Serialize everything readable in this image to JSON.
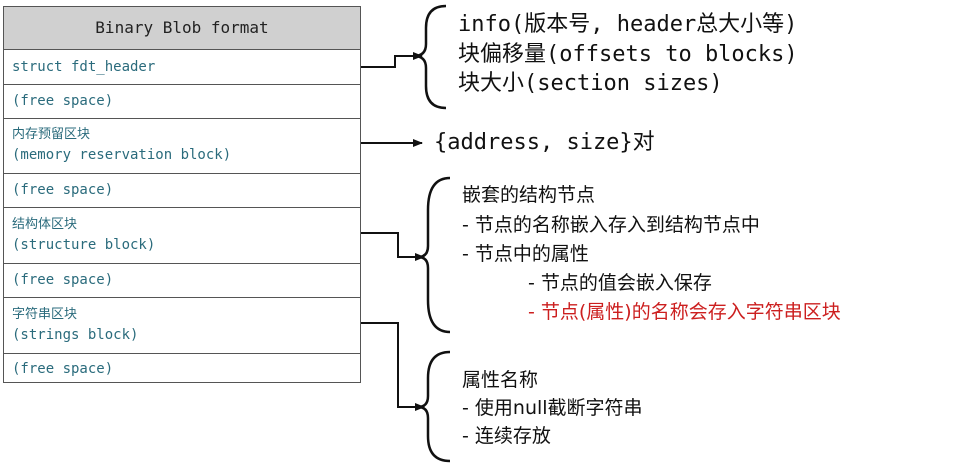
{
  "table": {
    "title": "Binary Blob format",
    "rows": [
      {
        "line1": "struct fdt_header",
        "line2": ""
      },
      {
        "line1": "(free space)",
        "line2": ""
      },
      {
        "line1": "内存预留区块",
        "line2": "(memory reservation block)"
      },
      {
        "line1": "(free space)",
        "line2": ""
      },
      {
        "line1": "结构体区块",
        "line2": "(structure block)"
      },
      {
        "line1": "(free space)",
        "line2": ""
      },
      {
        "line1": "字符串区块",
        "line2": "(strings block)"
      },
      {
        "line1": "(free space)",
        "line2": ""
      }
    ]
  },
  "header_info": {
    "lines": [
      "info(版本号, header总大小等)",
      "块偏移量(offsets to blocks)",
      "块大小(section sizes)"
    ]
  },
  "reservation_info": {
    "text": "{address, size}对"
  },
  "structure_info": {
    "lines": [
      "嵌套的结构节点",
      "-  节点的名称嵌入存入到结构节点中",
      "-  节点中的属性",
      "-  节点的值会嵌入保存",
      "-  节点(属性)的名称会存入字符串区块"
    ]
  },
  "strings_info": {
    "lines": [
      "属性名称",
      "-  使用null截断字符串",
      "-  连续存放"
    ]
  },
  "colors": {
    "table_text": "#2a6b7c",
    "header_fill": "#d0d0d0",
    "highlight": "#cc1f1f"
  }
}
